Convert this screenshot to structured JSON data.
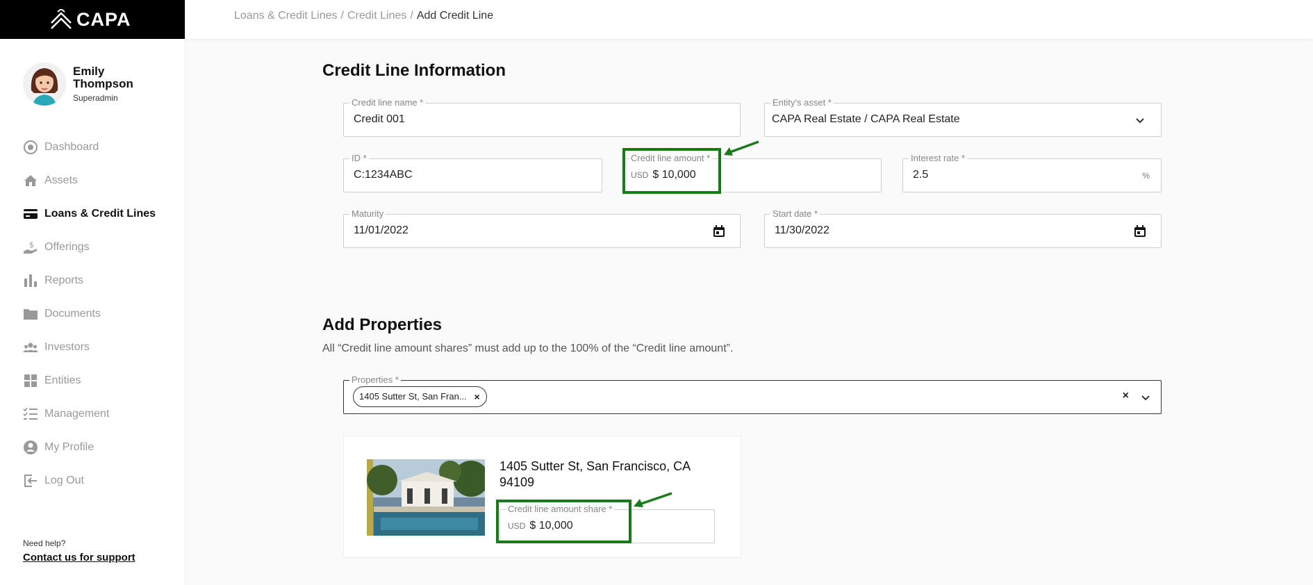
{
  "brand": {
    "name": "CAPA"
  },
  "user": {
    "name": "Emily Thompson",
    "role": "Superadmin"
  },
  "nav": [
    {
      "label": "Dashboard",
      "icon": "dashboard-icon",
      "active": false
    },
    {
      "label": "Assets",
      "icon": "home-icon",
      "active": false
    },
    {
      "label": "Loans & Credit Lines",
      "icon": "credit-card-icon",
      "active": true
    },
    {
      "label": "Offerings",
      "icon": "hand-money-icon",
      "active": false
    },
    {
      "label": "Reports",
      "icon": "bar-chart-icon",
      "active": false
    },
    {
      "label": "Documents",
      "icon": "folder-icon",
      "active": false
    },
    {
      "label": "Investors",
      "icon": "group-icon",
      "active": false
    },
    {
      "label": "Entities",
      "icon": "grid-icon",
      "active": false
    },
    {
      "label": "Management",
      "icon": "checklist-icon",
      "active": false
    },
    {
      "label": "My Profile",
      "icon": "user-circle-icon",
      "active": false
    },
    {
      "label": "Log Out",
      "icon": "logout-icon",
      "active": false
    }
  ],
  "help": {
    "question": "Need help?",
    "link": "Contact us for support"
  },
  "breadcrumb": {
    "level1": "Loans & Credit Lines",
    "level2": "Credit Lines",
    "current": "Add Credit Line",
    "separator": "/"
  },
  "credit_info": {
    "title": "Credit Line Information",
    "name": {
      "label": "Credit line name *",
      "value": "Credit 001"
    },
    "asset": {
      "label": "Entity's asset *",
      "value": "CAPA Real Estate / CAPA Real Estate"
    },
    "id": {
      "label": "ID *",
      "value": "C:1234ABC"
    },
    "amount": {
      "label": "Credit line amount *",
      "currency": "USD",
      "value": "$ 10,000"
    },
    "interest": {
      "label": "Interest rate *",
      "value": "2.5",
      "suffix": "%"
    },
    "maturity": {
      "label": "Maturity",
      "value": "11/01/2022"
    },
    "start": {
      "label": "Start date *",
      "value": "11/30/2022"
    }
  },
  "properties": {
    "title": "Add Properties",
    "note": "All “Credit line amount shares” must add up to the 100% of the “Credit line amount”.",
    "select_label": "Properties *",
    "chip": "1405 Sutter St, San Fran...",
    "card": {
      "title": "1405 Sutter St, San Francisco, CA 94109",
      "share_label": "Credit line amount share *",
      "currency": "USD",
      "share_value": "$ 10,000"
    }
  },
  "colors": {
    "accent_highlight": "#1a7a1a",
    "sidebar_header": "#000000"
  }
}
